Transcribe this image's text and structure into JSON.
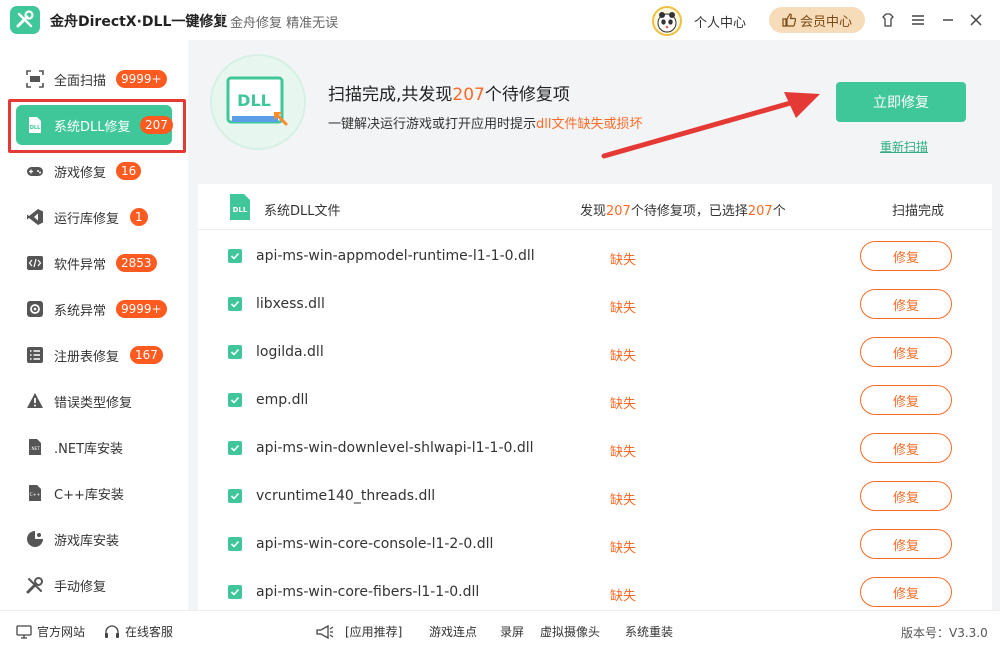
{
  "titlebar": {
    "title": "金舟DirectX·DLL一键修复",
    "slogan": "金舟修复 精准无误",
    "personal_center": "个人中心",
    "vip_center": "会员中心"
  },
  "sidebar": {
    "items": [
      {
        "label": "全面扫描",
        "badge": "9999+",
        "icon": "scan-icon"
      },
      {
        "label": "系统DLL修复",
        "badge": "207",
        "icon": "dll-file-icon",
        "active": true
      },
      {
        "label": "游戏修复",
        "badge": "16",
        "icon": "gamepad-icon"
      },
      {
        "label": "运行库修复",
        "badge": "1",
        "icon": "runtime-icon"
      },
      {
        "label": "软件异常",
        "badge": "2853",
        "icon": "code-file-icon"
      },
      {
        "label": "系统异常",
        "badge": "9999+",
        "icon": "gear-icon"
      },
      {
        "label": "注册表修复",
        "badge": "167",
        "icon": "registry-list-icon"
      },
      {
        "label": "错误类型修复",
        "badge": "",
        "icon": "warning-icon"
      },
      {
        "label": ".NET库安装",
        "badge": "",
        "icon": "dotnet-icon"
      },
      {
        "label": "C++库安装",
        "badge": "",
        "icon": "cpp-icon"
      },
      {
        "label": "游戏库安装",
        "badge": "",
        "icon": "game-lib-icon"
      },
      {
        "label": "手动修复",
        "badge": "",
        "icon": "wrench-icon"
      }
    ]
  },
  "hero": {
    "badge_text": "DLL",
    "title_prefix": "扫描完成,共发现",
    "title_count": "207",
    "title_suffix": "个待修复项",
    "desc_prefix": "一键解决运行游戏或打开应用时提示",
    "desc_highlight": "dll文件缺失或损坏",
    "fix_now": "立即修复",
    "rescan": "重新扫描"
  },
  "panel": {
    "head_icon_text": "DLL",
    "head_name": "系统DLL文件",
    "found_prefix": "发现",
    "found_count": "207",
    "found_mid": "个待修复项，已选择",
    "selected_count": "207",
    "found_suffix": "个",
    "status": "扫描完成",
    "rows": [
      {
        "name": "api-ms-win-appmodel-runtime-l1-1-0.dll",
        "status": "缺失",
        "action": "修复"
      },
      {
        "name": "libxess.dll",
        "status": "缺失",
        "action": "修复"
      },
      {
        "name": "logilda.dll",
        "status": "缺失",
        "action": "修复"
      },
      {
        "name": "emp.dll",
        "status": "缺失",
        "action": "修复"
      },
      {
        "name": "api-ms-win-downlevel-shlwapi-l1-1-0.dll",
        "status": "缺失",
        "action": "修复"
      },
      {
        "name": "vcruntime140_threads.dll",
        "status": "缺失",
        "action": "修复"
      },
      {
        "name": "api-ms-win-core-console-l1-2-0.dll",
        "status": "缺失",
        "action": "修复"
      },
      {
        "name": "api-ms-win-core-fibers-l1-1-0.dll",
        "status": "缺失",
        "action": "修复"
      }
    ]
  },
  "footer": {
    "official_site": "官方网站",
    "online_service": "在线客服",
    "recommend": "[应用推荐]",
    "links": [
      "游戏连点",
      "录屏",
      "虚拟摄像头",
      "系统重装"
    ],
    "version": "版本号：V3.3.0"
  },
  "colors": {
    "accent": "#3fc79a",
    "warning": "#ff6a26",
    "badge": "#ff5a1f",
    "annotation": "#e53935"
  }
}
